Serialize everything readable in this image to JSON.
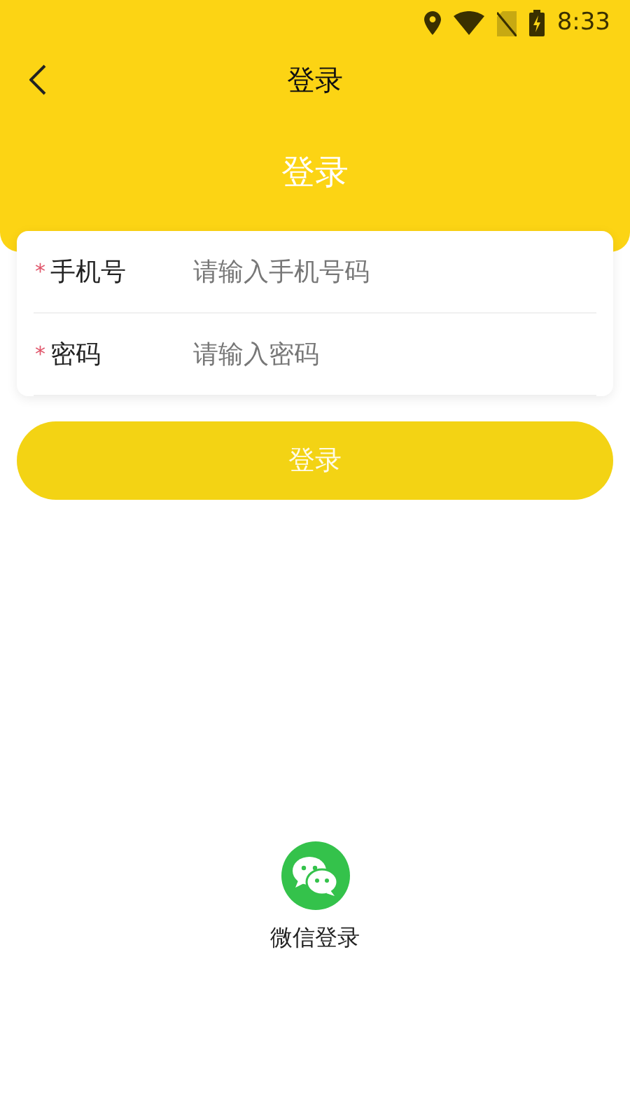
{
  "status_bar": {
    "time": "8:33"
  },
  "nav_bar": {
    "title": "登录"
  },
  "header": {
    "title": "登录"
  },
  "form": {
    "fields": [
      {
        "required_mark": "*",
        "label": "手机号",
        "placeholder": "请输入手机号码"
      },
      {
        "required_mark": "*",
        "label": "密码",
        "placeholder": "请输入密码"
      }
    ]
  },
  "login_button": {
    "label": "登录",
    "disabled": true
  },
  "wechat_login": {
    "label": "微信登录"
  }
}
